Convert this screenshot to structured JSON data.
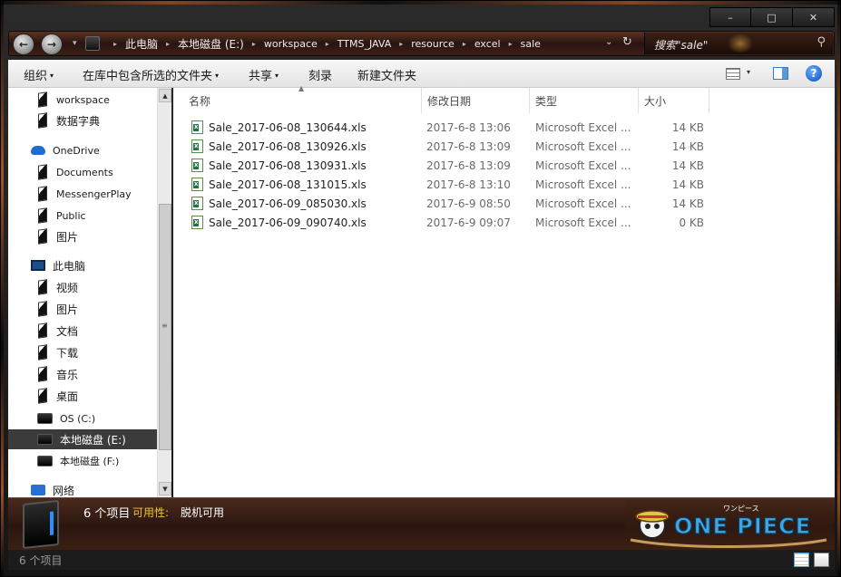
{
  "window": {
    "minimize_glyph": "–",
    "maximize_glyph": "□",
    "close_glyph": "✕"
  },
  "address": {
    "back_glyph": "←",
    "forward_glyph": "→",
    "crumbs": [
      "此电脑",
      "本地磁盘 (E:)",
      "workspace",
      "TTMS_JAVA",
      "resource",
      "excel",
      "sale"
    ],
    "separator": "▸",
    "refresh_glyph": "↻",
    "dropdown_glyph": "⌄"
  },
  "search": {
    "placeholder": "搜索\"sale\"",
    "icon_glyph": "⚲"
  },
  "toolbar": {
    "organize": "组织",
    "include_in_library": "在库中包含所选的文件夹",
    "share": "共享",
    "burn": "刻录",
    "new_folder": "新建文件夹",
    "caret": "▾",
    "help_glyph": "?"
  },
  "nav": {
    "items": [
      {
        "label": "workspace",
        "icon": "folder-icon"
      },
      {
        "label": "数据字典",
        "icon": "folder-icon"
      },
      {
        "label": "OneDrive",
        "icon": "onedrive-icon"
      },
      {
        "label": "Documents",
        "icon": "folder-icon"
      },
      {
        "label": "MessengerPlay",
        "icon": "folder-icon"
      },
      {
        "label": "Public",
        "icon": "folder-icon"
      },
      {
        "label": "图片",
        "icon": "folder-icon"
      },
      {
        "label": "此电脑",
        "icon": "this-pc-icon"
      },
      {
        "label": "视频",
        "icon": "videos-icon"
      },
      {
        "label": "图片",
        "icon": "pictures-icon"
      },
      {
        "label": "文档",
        "icon": "documents-icon"
      },
      {
        "label": "下载",
        "icon": "downloads-icon"
      },
      {
        "label": "音乐",
        "icon": "music-icon"
      },
      {
        "label": "桌面",
        "icon": "desktop-icon"
      },
      {
        "label": "OS (C:)",
        "icon": "drive-icon"
      },
      {
        "label": "本地磁盘 (E:)",
        "icon": "drive-icon"
      },
      {
        "label": "本地磁盘 (F:)",
        "icon": "drive-icon"
      },
      {
        "label": "网络",
        "icon": "network-icon"
      }
    ],
    "selected_label": "本地磁盘 (E:)"
  },
  "files": {
    "columns": {
      "name": "名称",
      "modified": "修改日期",
      "type": "类型",
      "size": "大小"
    },
    "rows": [
      {
        "name": "Sale_2017-06-08_130644.xls",
        "modified": "2017-6-8 13:06",
        "type": "Microsoft Excel ...",
        "size": "14 KB"
      },
      {
        "name": "Sale_2017-06-08_130926.xls",
        "modified": "2017-6-8 13:09",
        "type": "Microsoft Excel ...",
        "size": "14 KB"
      },
      {
        "name": "Sale_2017-06-08_130931.xls",
        "modified": "2017-6-8 13:09",
        "type": "Microsoft Excel ...",
        "size": "14 KB"
      },
      {
        "name": "Sale_2017-06-08_131015.xls",
        "modified": "2017-6-8 13:10",
        "type": "Microsoft Excel ...",
        "size": "14 KB"
      },
      {
        "name": "Sale_2017-06-09_085030.xls",
        "modified": "2017-6-9 08:50",
        "type": "Microsoft Excel ...",
        "size": "14 KB"
      },
      {
        "name": "Sale_2017-06-09_090740.xls",
        "modified": "2017-6-9 09:07",
        "type": "Microsoft Excel ...",
        "size": "0 KB"
      }
    ]
  },
  "details": {
    "count": "6 个项目",
    "availability_label": "可用性:",
    "availability_value": "脱机可用",
    "logo_text": "ONE PIECE",
    "logo_subtext": "ワンピース"
  },
  "status": {
    "text": "6 个项目"
  },
  "colors": {
    "accent_orange": "#d9691f",
    "availability_yellow": "#f0c437",
    "selection_bg": "#3b3b3b",
    "excel_green": "#217346"
  }
}
